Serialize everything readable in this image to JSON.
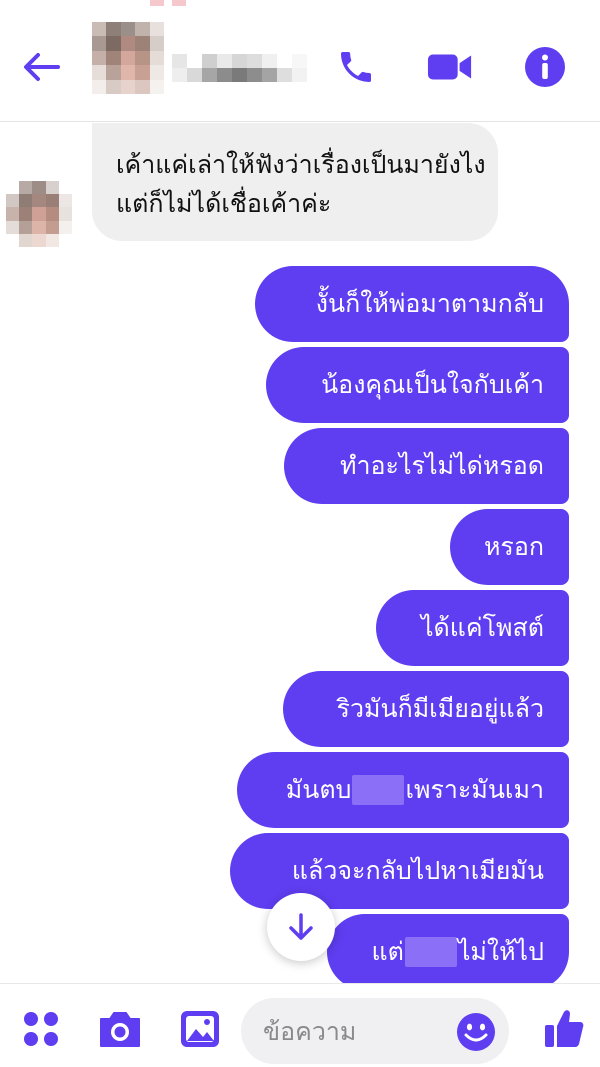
{
  "header": {
    "back_icon": "back-arrow-icon",
    "contact_name_visible": false,
    "call_icon": "phone-icon",
    "video_icon": "video-camera-icon",
    "info_icon": "info-icon"
  },
  "chat": {
    "incoming": {
      "text": "เค้าแค่เล่าให้ฟังว่าเรื่องเป็นมายังไง แต่ก็ไม่ได้เชื่อเค้าค่ะ"
    },
    "outgoing": [
      {
        "text": "งั้นก็ให้พ่อมาตามกลับ"
      },
      {
        "text": "น้องคุณเป็นใจกับเค้า"
      },
      {
        "text": "ทำอะไรไม่ได่หรอด"
      },
      {
        "text": "หรอก"
      },
      {
        "text": "ได้แค่โพสต์"
      },
      {
        "text": "ริวมันก็มีเมียอยู่แล้ว"
      },
      {
        "text_before": "มันตบ",
        "text_after": "เพราะมันเมา"
      },
      {
        "text": "แล้วจะกลับไปหาเมียมัน"
      },
      {
        "text_before": "แต่",
        "text_after": "ไม่ให้ไป"
      }
    ],
    "scroll_icon": "arrow-down-icon"
  },
  "composer": {
    "apps_icon": "apps-grid-icon",
    "camera_icon": "camera-icon",
    "gallery_icon": "image-icon",
    "placeholder": "ข้อความ",
    "emoji_icon": "smiley-icon",
    "like_icon": "thumbs-up-icon"
  },
  "colors": {
    "accent": "#5f3df1",
    "incoming_bubble": "#efeff0",
    "outgoing_text": "#ffffff"
  }
}
